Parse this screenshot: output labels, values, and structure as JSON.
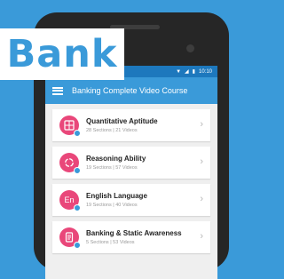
{
  "tag": {
    "label": "Bank"
  },
  "status": {
    "time": "10:10"
  },
  "appbar": {
    "title": "Banking Complete Video Course"
  },
  "items": [
    {
      "title": "Quantitative Aptitude",
      "sub": "28 Sections | 21 Videos",
      "icon": "calculator-icon"
    },
    {
      "title": "Reasoning Ability",
      "sub": "19 Sections | 57 Videos",
      "icon": "cycle-icon"
    },
    {
      "title": "English Language",
      "sub": "19 Sections | 40 Videos",
      "icon_text": "En",
      "icon": "english-icon"
    },
    {
      "title": "Banking & Static Awareness",
      "sub": "5 Sections | 53 Videos",
      "icon": "document-icon"
    }
  ],
  "colors": {
    "brand": "#3a9ad9",
    "icon_bg": "#e9477a"
  }
}
